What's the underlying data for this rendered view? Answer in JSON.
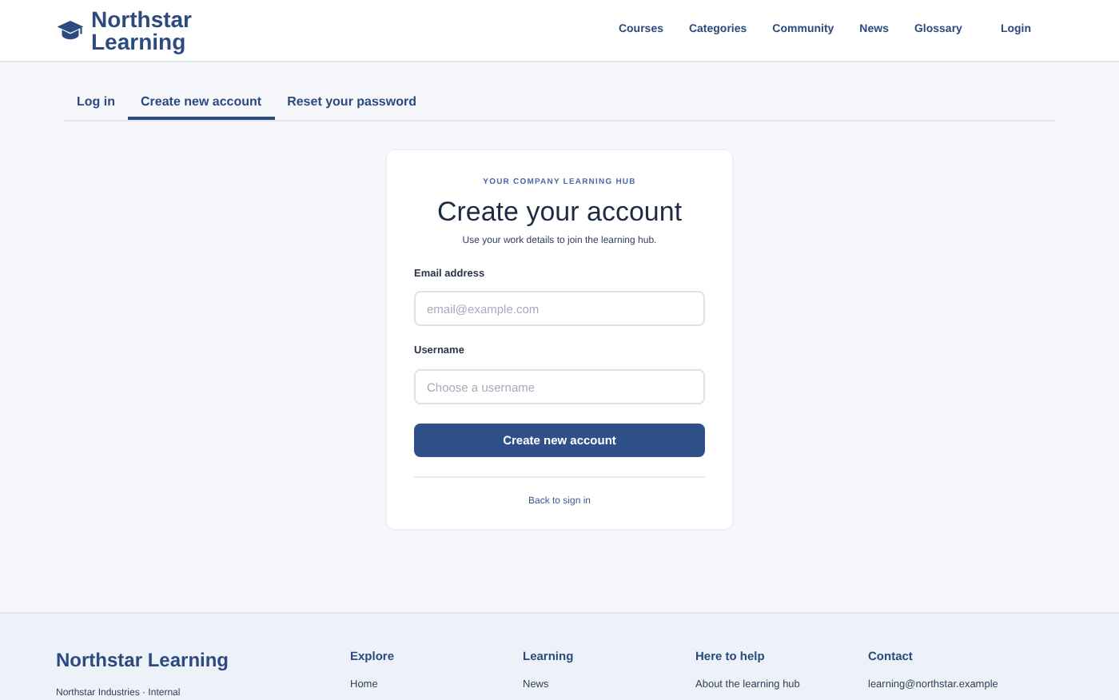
{
  "header": {
    "brand": "Northstar Learning",
    "nav": [
      {
        "label": "Courses"
      },
      {
        "label": "Categories"
      },
      {
        "label": "Community"
      },
      {
        "label": "News"
      },
      {
        "label": "Glossary"
      },
      {
        "label": "Login"
      }
    ]
  },
  "tabs": [
    {
      "label": "Log in",
      "selected": false
    },
    {
      "label": "Create new account",
      "selected": true
    },
    {
      "label": "Reset your password",
      "selected": false
    }
  ],
  "card": {
    "eyebrow": "YOUR COMPANY LEARNING HUB",
    "title": "Create your account",
    "subtitle": "Use your work details to join the learning hub.",
    "fields": [
      {
        "label": "Email address",
        "placeholder": "email@example.com"
      },
      {
        "label": "Username",
        "placeholder": "Choose a username"
      }
    ],
    "submit": "Create new account",
    "back_link": "Back to sign in"
  },
  "footer": {
    "brand": "Northstar Learning",
    "tagline": "Northstar Industries · Internal",
    "columns": [
      {
        "heading": "Explore",
        "links": [
          "Home"
        ]
      },
      {
        "heading": "Learning",
        "links": [
          "News"
        ]
      },
      {
        "heading": "Here to help",
        "links": [
          "About the learning hub"
        ]
      },
      {
        "heading": "Contact",
        "links": [
          "learning@northstar.example"
        ]
      }
    ]
  }
}
